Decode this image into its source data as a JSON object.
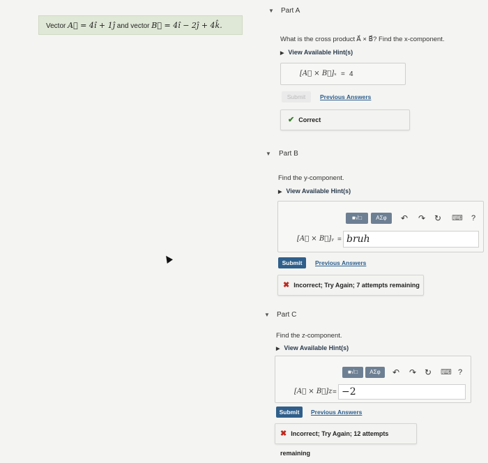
{
  "problem": {
    "prefix": "Vector ",
    "vecA": "A⃗ = 4î + 1ĵ",
    "mid": " and vector ",
    "vecB": "B⃗ = 4î − 2ĵ + 4k̂."
  },
  "partA": {
    "title": "Part A",
    "question": "What is the cross product A⃗ × B⃗? Find the x-component.",
    "hint_label": "View Available Hint(s)",
    "expr": "[A⃗ × B⃗]ₓ",
    "equals": "=",
    "value": "4",
    "submit_label": "Submit",
    "prev_label": "Previous Answers",
    "feedback": "Correct"
  },
  "partB": {
    "title": "Part B",
    "question": "Find the y-component.",
    "hint_label": "View Available Hint(s)",
    "expr": "[A⃗ × B⃗]ᵧ",
    "equals": "=",
    "input_value": "bruh",
    "submit_label": "Submit",
    "prev_label": "Previous Answers",
    "feedback": "Incorrect; Try Again; 7 attempts remaining"
  },
  "partC": {
    "title": "Part C",
    "question": "Find the z-component.",
    "hint_label": "View Available Hint(s)",
    "expr": "[A⃗ × B⃗]z",
    "equals": "=",
    "input_value": "−2",
    "submit_label": "Submit",
    "prev_label": "Previous Answers",
    "feedback": "Incorrect; Try Again; 12 attempts remaining"
  },
  "toolbar": {
    "template_label": "■√□",
    "symbol_label": "ΑΣφ",
    "undo_icon": "↶",
    "redo_icon": "↷",
    "reset_icon": "↻",
    "keyboard_icon": "⌨",
    "help_label": "?"
  },
  "colors": {
    "accent": "#2f5f8a",
    "correct": "#3a7d2c",
    "incorrect": "#c0281e",
    "problem_bg": "#dfe8d6"
  }
}
